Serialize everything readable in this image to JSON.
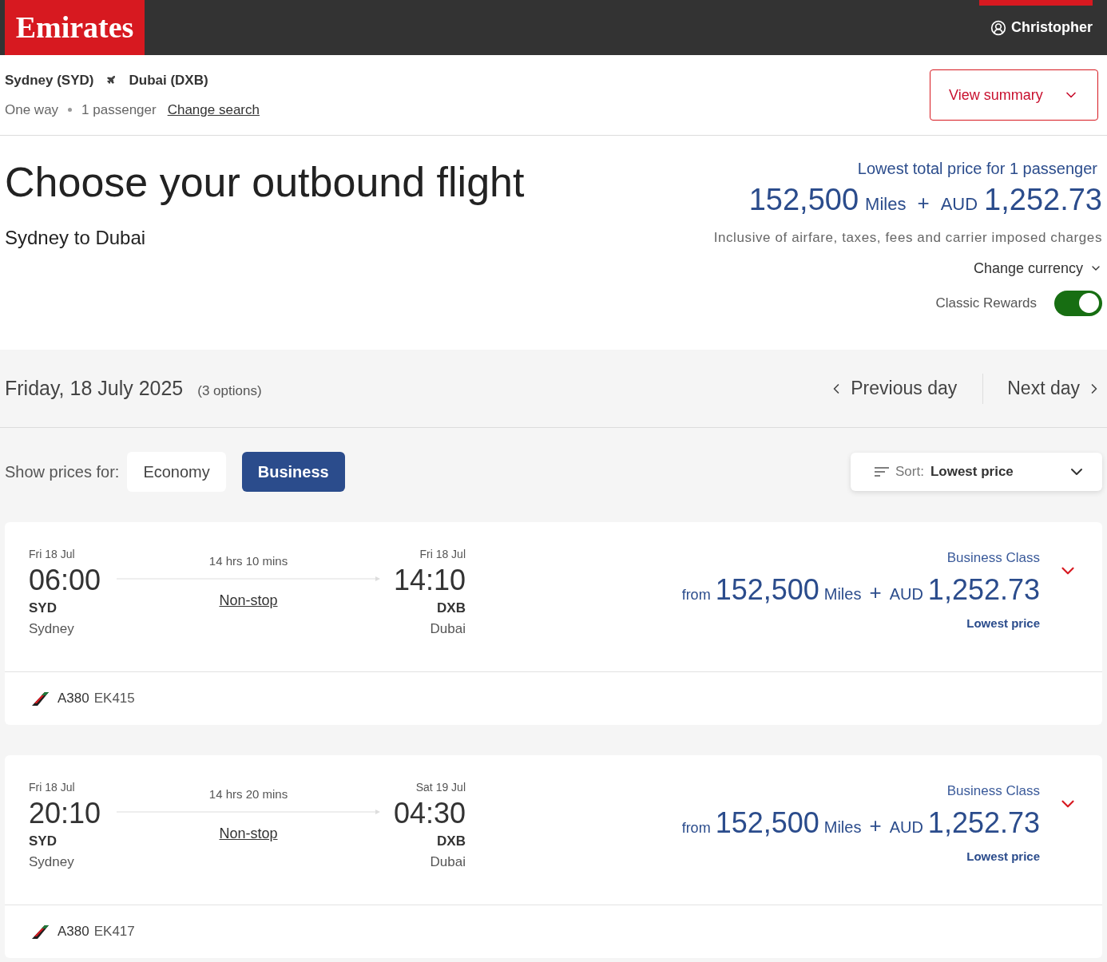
{
  "header": {
    "logo": "Emirates",
    "user": "Christopher"
  },
  "search": {
    "origin": "Sydney (SYD)",
    "destination": "Dubai (DXB)",
    "trip_type": "One way",
    "passengers": "1 passenger",
    "change_search": "Change search",
    "view_summary": "View summary"
  },
  "hero": {
    "title": "Choose your outbound flight",
    "subtitle": "Sydney to Dubai",
    "price_label": "Lowest total price for 1 passenger",
    "miles": "152,500",
    "miles_unit": "Miles",
    "plus": "+",
    "currency": "AUD",
    "amount": "1,252.73",
    "note": "Inclusive of airfare, taxes, fees and carrier imposed charges",
    "change_currency": "Change currency",
    "classic_rewards": {
      "label": "Classic Rewards",
      "on": true
    }
  },
  "date_bar": {
    "date": "Friday, 18 July 2025",
    "options": "(3 options)",
    "previous": "Previous day",
    "next": "Next day"
  },
  "cabin": {
    "label": "Show prices for:",
    "options": [
      {
        "label": "Economy",
        "selected": false
      },
      {
        "label": "Business",
        "selected": true
      }
    ],
    "sort": {
      "label": "Sort:",
      "value": "Lowest price"
    }
  },
  "flights": [
    {
      "dep_date": "Fri 18 Jul",
      "dep_time": "06:00",
      "dep_code": "SYD",
      "dep_city": "Sydney",
      "duration": "14 hrs 10 mins",
      "stops": "Non-stop",
      "arr_date": "Fri 18 Jul",
      "arr_time": "14:10",
      "arr_code": "DXB",
      "arr_city": "Dubai",
      "cabin_class": "Business Class",
      "from": "from",
      "miles": "152,500",
      "miles_unit": "Miles",
      "plus": "+",
      "currency": "AUD",
      "amount": "1,252.73",
      "badge": "Lowest price",
      "aircraft": "A380",
      "flight_number": "EK415"
    },
    {
      "dep_date": "Fri 18 Jul",
      "dep_time": "20:10",
      "dep_code": "SYD",
      "dep_city": "Sydney",
      "duration": "14 hrs 20 mins",
      "stops": "Non-stop",
      "arr_date": "Sat 19 Jul",
      "arr_time": "04:30",
      "arr_code": "DXB",
      "arr_city": "Dubai",
      "cabin_class": "Business Class",
      "from": "from",
      "miles": "152,500",
      "miles_unit": "Miles",
      "plus": "+",
      "currency": "AUD",
      "amount": "1,252.73",
      "badge": "Lowest price",
      "aircraft": "A380",
      "flight_number": "EK417"
    }
  ]
}
